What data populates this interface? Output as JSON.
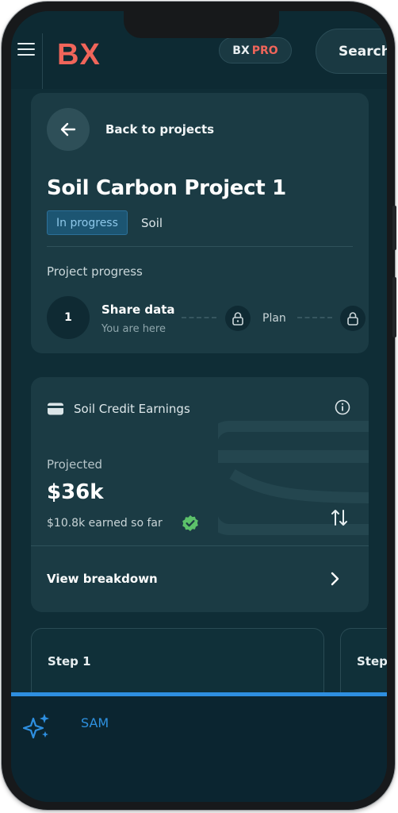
{
  "header": {
    "menu_icon": "hamburger-icon",
    "logo": "BX",
    "pro_badge": {
      "brand": "BX",
      "tier": "PRO"
    },
    "search_label": "Search"
  },
  "project": {
    "back_label": "Back to projects",
    "title": "Soil Carbon Project 1",
    "status": "In progress",
    "category": "Soil",
    "progress_title": "Project progress",
    "steps": [
      {
        "number": "1",
        "name": "Share data",
        "sub": "You are here",
        "state": "current"
      },
      {
        "name": "Plan",
        "state": "locked"
      },
      {
        "name": "",
        "state": "locked"
      }
    ]
  },
  "earnings": {
    "title": "Soil Credit Earnings",
    "projected_label": "Projected",
    "projected_value": "$36k",
    "earned_label": "$10.8k earned so far",
    "breakdown_label": "View breakdown"
  },
  "step_cards": [
    {
      "label": "Step 1"
    },
    {
      "label": "Step"
    }
  ],
  "assistant": {
    "label": "SAM"
  },
  "colors": {
    "background": "#0f2d36",
    "card": "#1b3b44",
    "brand": "#f0655a",
    "status_badge": "#1c5572",
    "accent_blue": "#2e8fe0",
    "check_green": "#5cc16a"
  }
}
